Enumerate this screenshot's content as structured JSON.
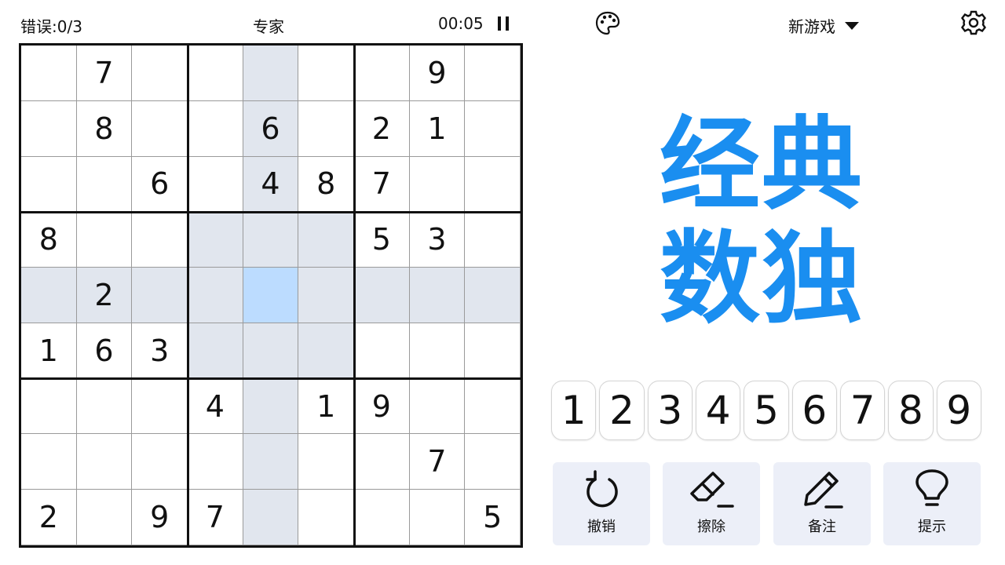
{
  "header": {
    "mistakes": "错误:0/3",
    "difficulty": "专家",
    "timer": "00:05",
    "new_game_label": "新游戏"
  },
  "title": {
    "line1": "经典",
    "line2": "数独"
  },
  "board": {
    "cells": [
      [
        "",
        "7",
        "",
        "",
        "",
        "",
        "",
        "9",
        ""
      ],
      [
        "",
        "8",
        "",
        "",
        "6",
        "",
        "2",
        "1",
        ""
      ],
      [
        "",
        "",
        "6",
        "",
        "4",
        "8",
        "7",
        "",
        ""
      ],
      [
        "8",
        "",
        "",
        "",
        "",
        "",
        "5",
        "3",
        ""
      ],
      [
        "",
        "2",
        "",
        "",
        "",
        "",
        "",
        "",
        ""
      ],
      [
        "1",
        "6",
        "3",
        "",
        "",
        "",
        "",
        "",
        ""
      ],
      [
        "",
        "",
        "",
        "4",
        "",
        "1",
        "9",
        "",
        ""
      ],
      [
        "",
        "",
        "",
        "",
        "",
        "",
        "",
        "7",
        ""
      ],
      [
        "2",
        "",
        "9",
        "7",
        "",
        "",
        "",
        "",
        "5"
      ]
    ],
    "selected": {
      "row": 4,
      "col": 4
    },
    "highlight_color": "#e1e6ee",
    "selected_color": "#bcdcff"
  },
  "numpad": [
    "1",
    "2",
    "3",
    "4",
    "5",
    "6",
    "7",
    "8",
    "9"
  ],
  "tools": [
    {
      "label": "撤销",
      "icon": "undo-icon"
    },
    {
      "label": "擦除",
      "icon": "eraser-icon"
    },
    {
      "label": "备注",
      "icon": "pencil-icon"
    },
    {
      "label": "提示",
      "icon": "lightbulb-icon"
    }
  ],
  "colors": {
    "accent": "#1a8ef0",
    "tool_bg": "#eceff8"
  }
}
